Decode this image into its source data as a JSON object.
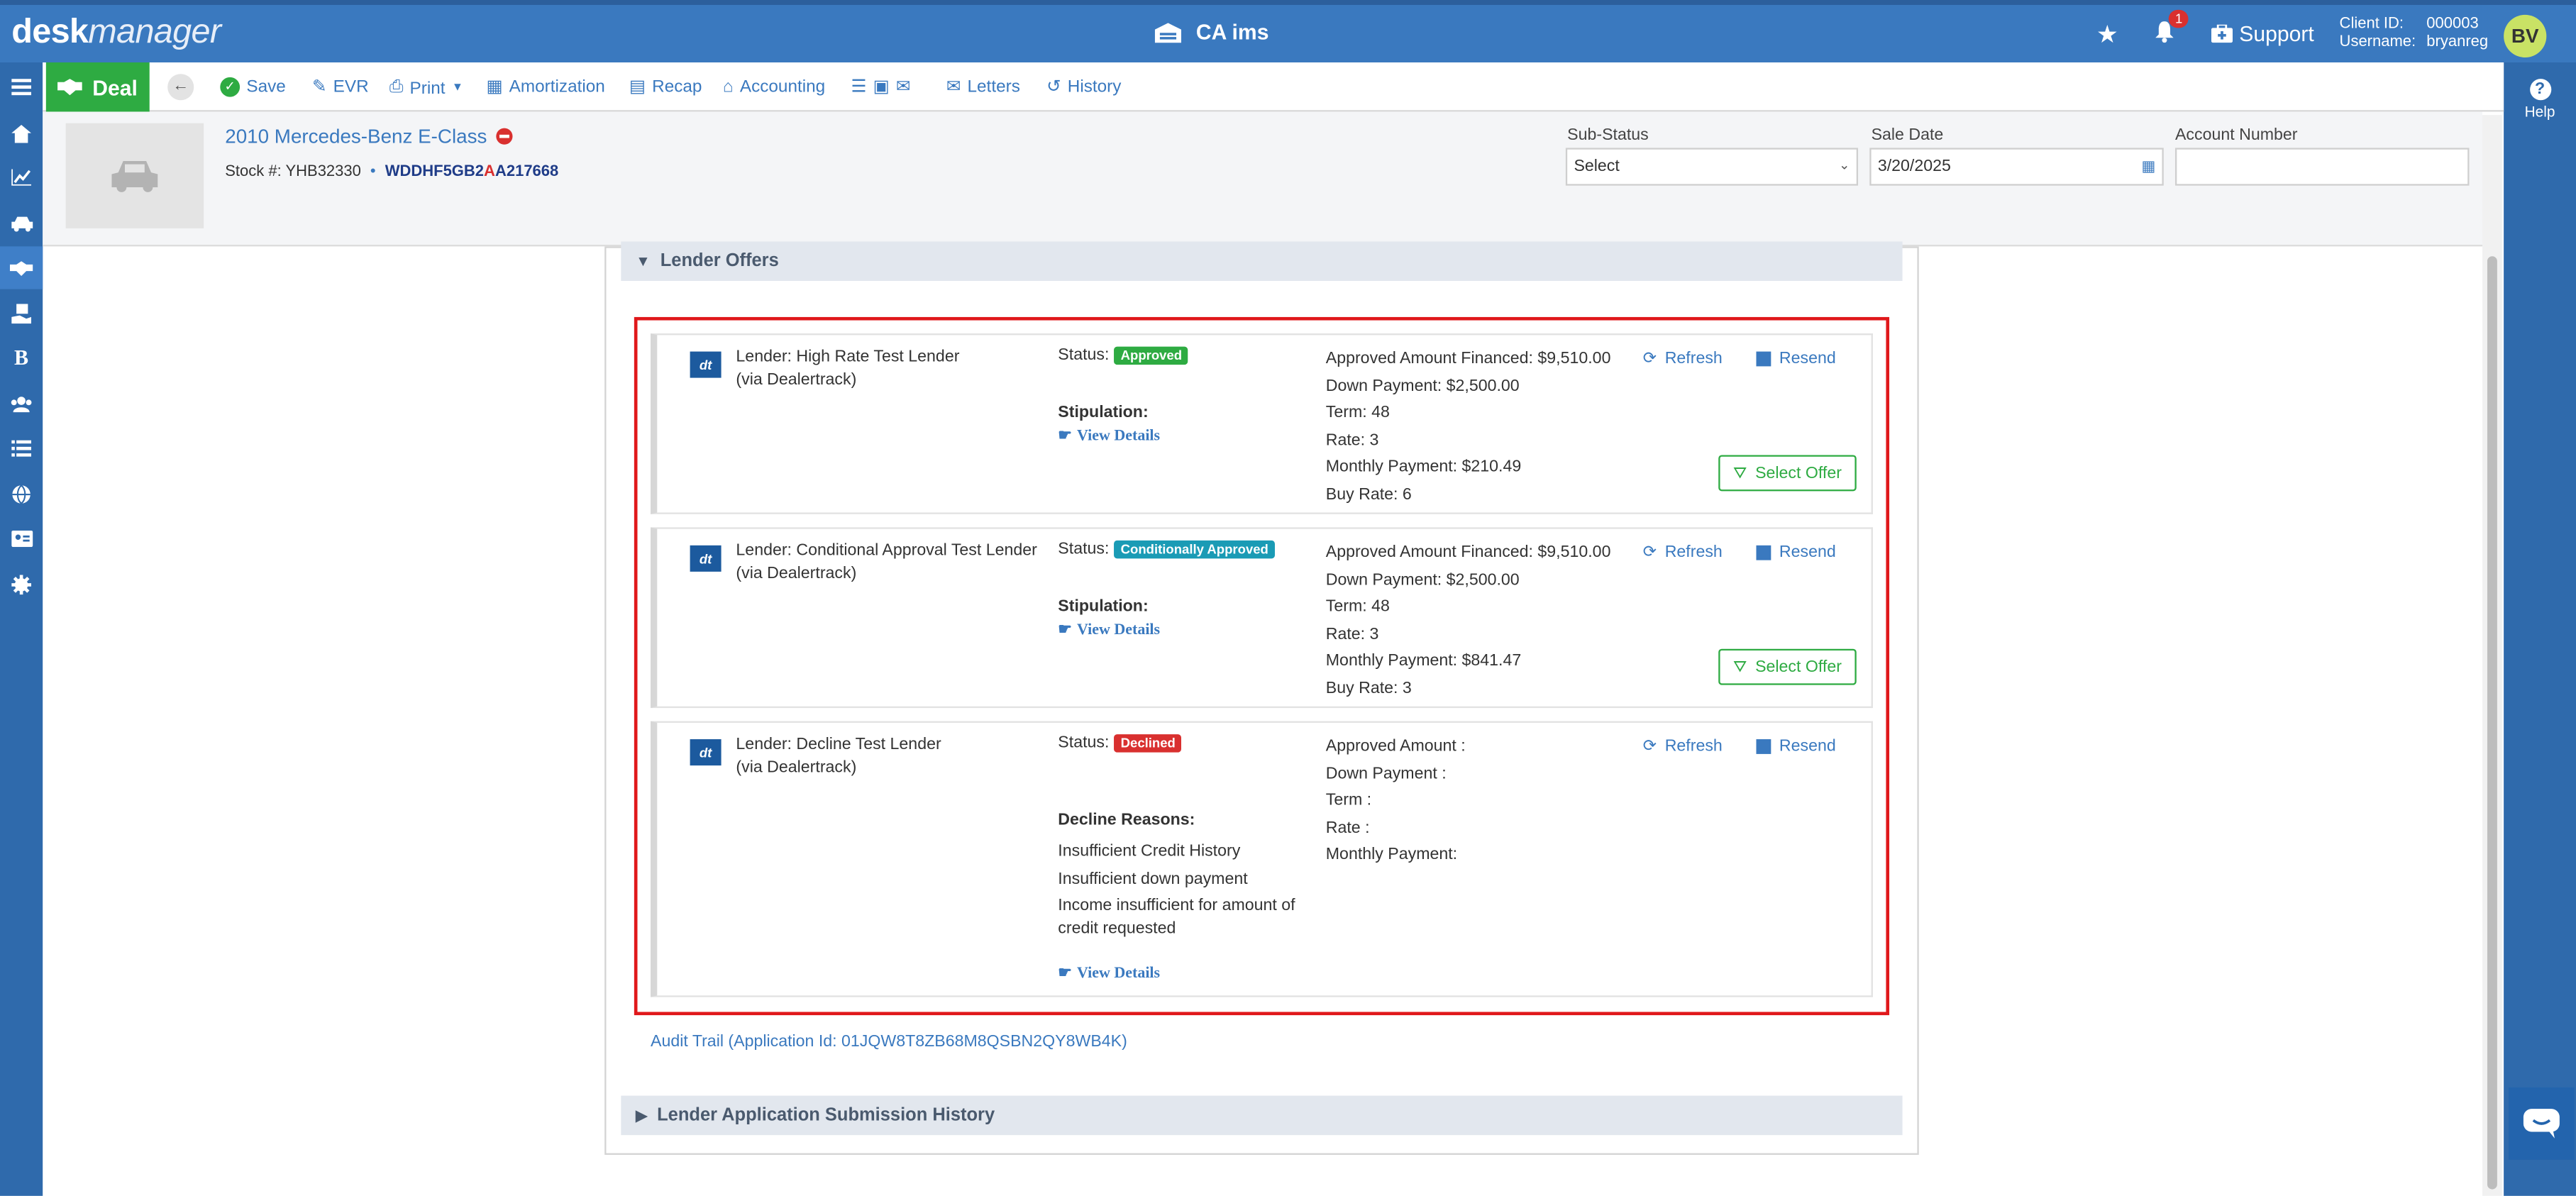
{
  "app": {
    "logo_bold": "desk",
    "logo_light": "manager",
    "center_title": "CA ims",
    "notifications": "1",
    "support": "Support",
    "client_id_label": "Client ID:",
    "client_id": "000003",
    "username_label": "Username:",
    "username": "bryanreg",
    "avatar": "BV",
    "help": "Help"
  },
  "toolbar": {
    "deal": "Deal",
    "save": "Save",
    "evr": "EVR",
    "print": "Print",
    "amortization": "Amortization",
    "recap": "Recap",
    "accounting": "Accounting",
    "letters": "Letters",
    "history": "History"
  },
  "vehicle": {
    "title": "2010 Mercedes-Benz E-Class",
    "stock_label": "Stock #:",
    "stock": "YHB32330",
    "bullet": "•",
    "vin_a": "WDDHF5GB2",
    "vin_b": "A",
    "vin_c": "A217668"
  },
  "fields": {
    "sub_status_label": "Sub-Status",
    "sub_status": "Select",
    "sale_date_label": "Sale Date",
    "sale_date": "3/20/2025",
    "account_label": "Account Number",
    "account": ""
  },
  "sections": {
    "lender_offers": "Lender Offers",
    "history": "Lender Application Submission History"
  },
  "offers": [
    {
      "lender": "Lender: High Rate Test Lender",
      "via": "(via Dealertrack)",
      "status_label": "Status:",
      "status": "Approved",
      "status_color": "#2eab42",
      "stip_label": "Stipulation:",
      "view": "View Details",
      "amount": "Approved Amount Financed: $9,510.00",
      "down": "Down Payment: $2,500.00",
      "term": "Term: 48",
      "rate": "Rate: 3",
      "monthly": "Monthly Payment: $210.49",
      "buy": "Buy Rate: 6",
      "refresh": "Refresh",
      "resend": "Resend",
      "select": "Select Offer"
    },
    {
      "lender": "Lender: Conditional Approval Test Lender",
      "via": "(via Dealertrack)",
      "status_label": "Status:",
      "status": "Conditionally Approved",
      "status_color": "#1a9bb5",
      "stip_label": "Stipulation:",
      "view": "View Details",
      "amount": "Approved Amount Financed: $9,510.00",
      "down": "Down Payment: $2,500.00",
      "term": "Term: 48",
      "rate": "Rate: 3",
      "monthly": "Monthly Payment: $841.47",
      "buy": "Buy Rate: 3",
      "refresh": "Refresh",
      "resend": "Resend",
      "select": "Select Offer"
    },
    {
      "lender": "Lender: Decline Test Lender",
      "via": "(via Dealertrack)",
      "status_label": "Status:",
      "status": "Declined",
      "status_color": "#d9302f",
      "reasons_label": "Decline Reasons:",
      "reasons": [
        "Insufficient Credit History",
        "Insufficient down payment",
        "Income insufficient for amount of credit requested"
      ],
      "view": "View Details",
      "amount": "Approved Amount :",
      "down": "Down Payment :",
      "term": "Term :",
      "rate": "Rate :",
      "monthly": "Monthly Payment:",
      "refresh": "Refresh",
      "resend": "Resend"
    }
  ],
  "audit": "Audit Trail (Application Id: 01JQW8T8ZB68M8QSBN2QY8WB4K)",
  "dt_logo": "dt"
}
